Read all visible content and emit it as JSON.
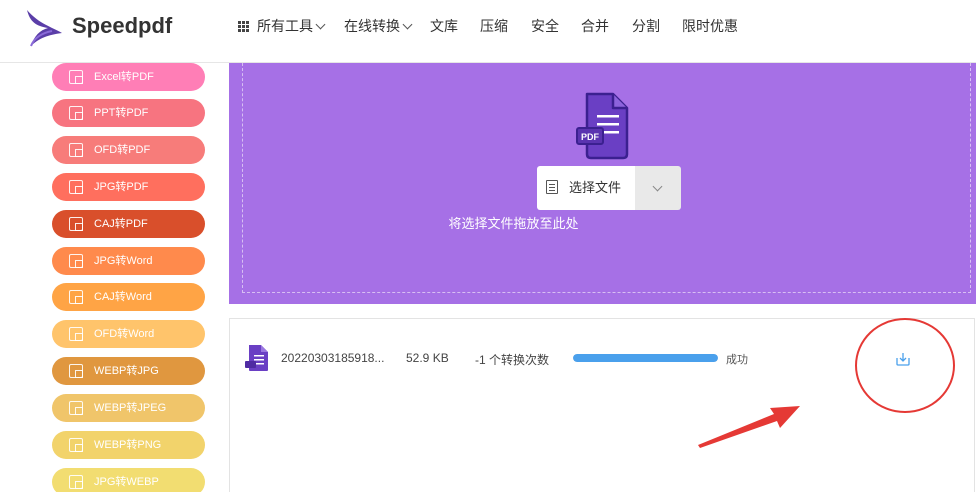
{
  "header": {
    "brand": "Speedpdf",
    "nav": [
      {
        "label": "所有工具",
        "has_dropdown": true,
        "icon": "grid-icon"
      },
      {
        "label": "在线转换",
        "has_dropdown": true
      },
      {
        "label": "文库"
      },
      {
        "label": "压缩"
      },
      {
        "label": "安全"
      },
      {
        "label": "合并"
      },
      {
        "label": "分割"
      },
      {
        "label": "限时优惠"
      }
    ]
  },
  "sidebar": {
    "items": [
      {
        "label": "Excel转PDF",
        "color": "#ff7eb6"
      },
      {
        "label": "PPT转PDF",
        "color": "#f77480"
      },
      {
        "label": "OFD转PDF",
        "color": "#f77c7a"
      },
      {
        "label": "JPG转PDF",
        "color": "#ff6f5e"
      },
      {
        "label": "CAJ转PDF",
        "color": "#d94f2b"
      },
      {
        "label": "JPG转Word",
        "color": "#ff8a4c"
      },
      {
        "label": "CAJ转Word",
        "color": "#ffa445"
      },
      {
        "label": "OFD转Word",
        "color": "#ffc46b"
      },
      {
        "label": "WEBP转JPG",
        "color": "#e0973f"
      },
      {
        "label": "WEBP转JPEG",
        "color": "#f0c56a"
      },
      {
        "label": "WEBP转PNG",
        "color": "#f2d36b"
      },
      {
        "label": "JPG转WEBP",
        "color": "#f2dd71"
      }
    ]
  },
  "upload": {
    "doc_badge": "PDF",
    "choose_label": "选择文件",
    "drop_hint": "将选择文件拖放至此处"
  },
  "file": {
    "name": "20220303185918...",
    "size": "52.9 KB",
    "count": "-1 个转换次数",
    "progress": 1.0,
    "status": "成功",
    "download_icon": "download-icon"
  },
  "colors": {
    "upload_bg": "#a670e6",
    "progress": "#4aa0ec",
    "annotation": "#e53935"
  }
}
